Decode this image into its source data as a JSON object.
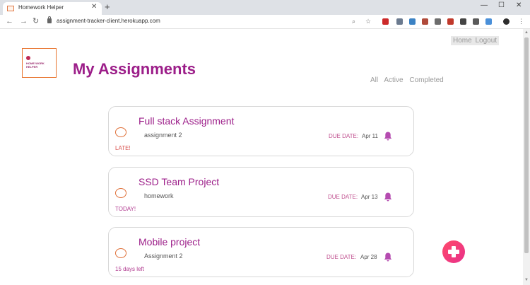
{
  "browser": {
    "tab_title": "Homework Helper",
    "tab_close": "✕",
    "new_tab": "+",
    "url": "assignment-tracker-client.herokuapp.com",
    "window_controls": {
      "minimize": "—",
      "maximize": "☐",
      "close": "✕"
    },
    "nav": {
      "back": "←",
      "forward": "→",
      "reload": "↻"
    },
    "toolbar_glyphs": {
      "zoom": "⌕",
      "star": "☆",
      "menu": "⋮"
    },
    "extension_colors": [
      "#cc2929",
      "#6b7a8f",
      "#3b82c4",
      "#b04a3a",
      "#6d6d6d",
      "#c0392b",
      "#444444",
      "#5a5a5a",
      "#4a90d9",
      "#2d2d2d"
    ]
  },
  "header": {
    "nav_home": "Home",
    "nav_logout": "Logout",
    "logo_text": "HOME WORK HELPER",
    "title": "My Assignments"
  },
  "filters": [
    "All",
    "Active",
    "Completed"
  ],
  "assignments": [
    {
      "title": "Full stack Assignment",
      "description": "assignment 2",
      "due_label": "DUE DATE:",
      "due_date": "Apr 11",
      "status": "LATE!",
      "status_color": "#d9534f"
    },
    {
      "title": "SSD Team Project",
      "description": "homework",
      "due_label": "DUE DATE:",
      "due_date": "Apr 13",
      "status": "TODAY!",
      "status_color": "#b0398f"
    },
    {
      "title": "Mobile project",
      "description": "Assignment 2",
      "due_label": "DUE DATE:",
      "due_date": "Apr 28",
      "status": "15 days left",
      "status_color": "#b0398f"
    }
  ],
  "colors": {
    "accent": "#9c1e89",
    "check_orange": "#e0713a",
    "bell": "#b54bb0",
    "add_button": "#f03a78"
  }
}
